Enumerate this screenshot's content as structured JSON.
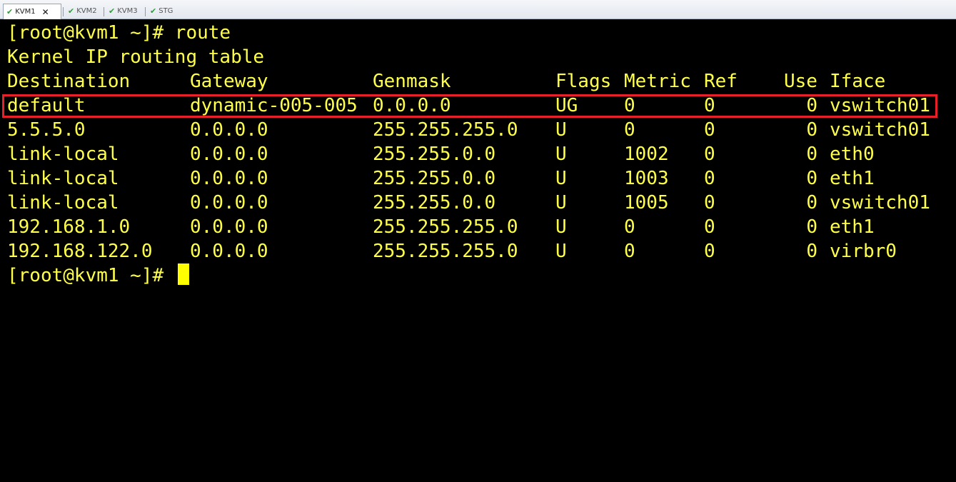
{
  "tabs": [
    {
      "label": "KVM1",
      "active": true,
      "icon": "check-icon",
      "closable": true
    },
    {
      "label": "KVM2",
      "active": false,
      "icon": "check-icon"
    },
    {
      "label": "KVM3",
      "active": false,
      "icon": "check-icon"
    },
    {
      "label": "STG",
      "active": false,
      "icon": "check-icon"
    }
  ],
  "colors": {
    "terminal_bg": "#000000",
    "terminal_text": "#ffff4a",
    "highlight_border": "#e8202a",
    "check": "#2f9e3a"
  },
  "terminal": {
    "command_line": "[root@kvm1 ~]# route",
    "heading": "Kernel IP routing table",
    "prompt": "[root@kvm1 ~]#",
    "headers": [
      "Destination",
      "Gateway",
      "Genmask",
      "Flags",
      "Metric",
      "Ref",
      "Use",
      "Iface"
    ],
    "rows": [
      [
        "default",
        "dynamic-005-005",
        "0.0.0.0",
        "UG",
        "0",
        "0",
        "0",
        "vswitch01"
      ],
      [
        "5.5.5.0",
        "0.0.0.0",
        "255.255.255.0",
        "U",
        "0",
        "0",
        "0",
        "vswitch01"
      ],
      [
        "link-local",
        "0.0.0.0",
        "255.255.0.0",
        "U",
        "1002",
        "0",
        "0",
        "eth0"
      ],
      [
        "link-local",
        "0.0.0.0",
        "255.255.0.0",
        "U",
        "1003",
        "0",
        "0",
        "eth1"
      ],
      [
        "link-local",
        "0.0.0.0",
        "255.255.0.0",
        "U",
        "1005",
        "0",
        "0",
        "vswitch01"
      ],
      [
        "192.168.1.0",
        "0.0.0.0",
        "255.255.255.0",
        "U",
        "0",
        "0",
        "0",
        "eth1"
      ],
      [
        "192.168.122.0",
        "0.0.0.0",
        "255.255.255.0",
        "U",
        "0",
        "0",
        "0",
        "virbr0"
      ]
    ],
    "highlighted_row": 0
  }
}
